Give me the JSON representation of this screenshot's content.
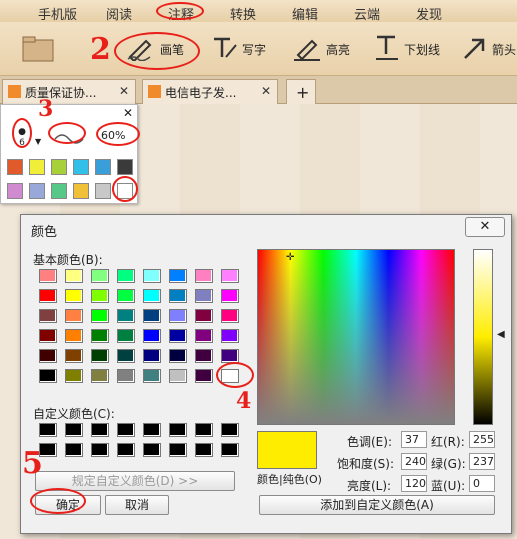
{
  "menu": {
    "tabs": [
      "手机版",
      "阅读",
      "注释",
      "转换",
      "编辑",
      "云端",
      "发现"
    ],
    "active_tab": "注释"
  },
  "toolbar": {
    "pen": "画笔",
    "write": "写字",
    "highlight": "高亮",
    "underline": "下划线",
    "arrow": "箭头"
  },
  "doc_tabs": [
    {
      "title": "质量保证协..."
    },
    {
      "title": "电信电子发..."
    }
  ],
  "pen_popup": {
    "size": "6",
    "opacity": "60%",
    "row1_colors": [
      "#e05a2c",
      "#f0ee38",
      "#a8d038",
      "#32c0e8",
      "#3a9ed8",
      "#3a3a3a"
    ],
    "row2_colors": [
      "#d08ad0",
      "#98a8d8",
      "#58c888",
      "#f0c038",
      "#c8c8c8",
      "#ffffff"
    ]
  },
  "dialog": {
    "title": "颜色",
    "close": "✕",
    "basic_colors_label": "基本颜色(B):",
    "custom_colors_label": "自定义颜色(C):",
    "define_custom": "规定自定义颜色(D) >>",
    "ok": "确定",
    "cancel": "取消",
    "color_solid": "颜色|纯色(O)",
    "add_custom": "添加到自定义颜色(A)",
    "hue_label": "色调(E):",
    "hue": "37",
    "sat_label": "饱和度(S):",
    "sat": "240",
    "lum_label": "亮度(L):",
    "lum": "120",
    "red_label": "红(R):",
    "red": "255",
    "green_label": "绿(G):",
    "green": "237",
    "blue_label": "蓝(U):",
    "blue": "0",
    "current_color": "#ffed00",
    "basic_colors": [
      [
        "#ff8080",
        "#ffff80",
        "#80ff80",
        "#00ff80",
        "#80ffff",
        "#0080ff",
        "#ff80c0",
        "#ff80ff"
      ],
      [
        "#ff0000",
        "#ffff00",
        "#80ff00",
        "#00ff40",
        "#00ffff",
        "#0080c0",
        "#8080c0",
        "#ff00ff"
      ],
      [
        "#804040",
        "#ff8040",
        "#00ff00",
        "#008080",
        "#004080",
        "#8080ff",
        "#800040",
        "#ff0080"
      ],
      [
        "#800000",
        "#ff8000",
        "#008000",
        "#008040",
        "#0000ff",
        "#0000a0",
        "#800080",
        "#8000ff"
      ],
      [
        "#400000",
        "#804000",
        "#004000",
        "#004040",
        "#000080",
        "#000040",
        "#400040",
        "#400080"
      ],
      [
        "#000000",
        "#808000",
        "#808040",
        "#808080",
        "#408080",
        "#c0c0c0",
        "#400040",
        "#ffffff"
      ]
    ]
  },
  "annotations": {
    "n2": "2",
    "n3": "3",
    "n4": "4",
    "n5": "5"
  }
}
